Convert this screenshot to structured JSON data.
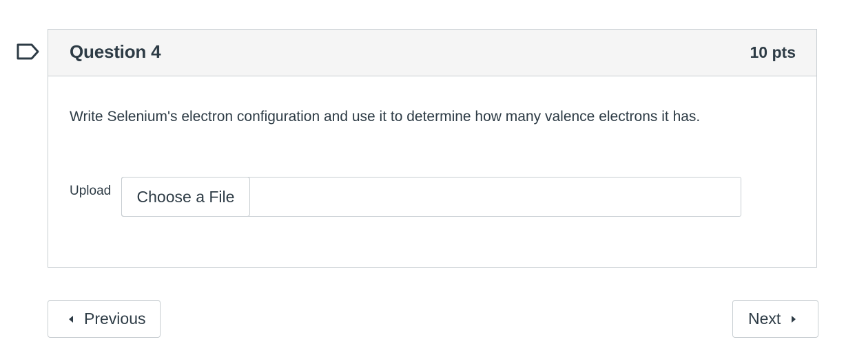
{
  "question": {
    "title": "Question 4",
    "points": "10 pts",
    "text": "Write Selenium's electron configuration and use it to determine how many valence electrons it has.",
    "flag_icon": "flag-outline-icon"
  },
  "upload": {
    "label": "Upload",
    "button_label": "Choose a File"
  },
  "navigation": {
    "previous_label": "Previous",
    "next_label": "Next",
    "previous_icon": "caret-left-icon",
    "next_icon": "caret-right-icon"
  },
  "colors": {
    "text": "#2d3b45",
    "border": "#c7cdd1",
    "header_bg": "#f5f5f5",
    "flag": "#2d3b45"
  }
}
